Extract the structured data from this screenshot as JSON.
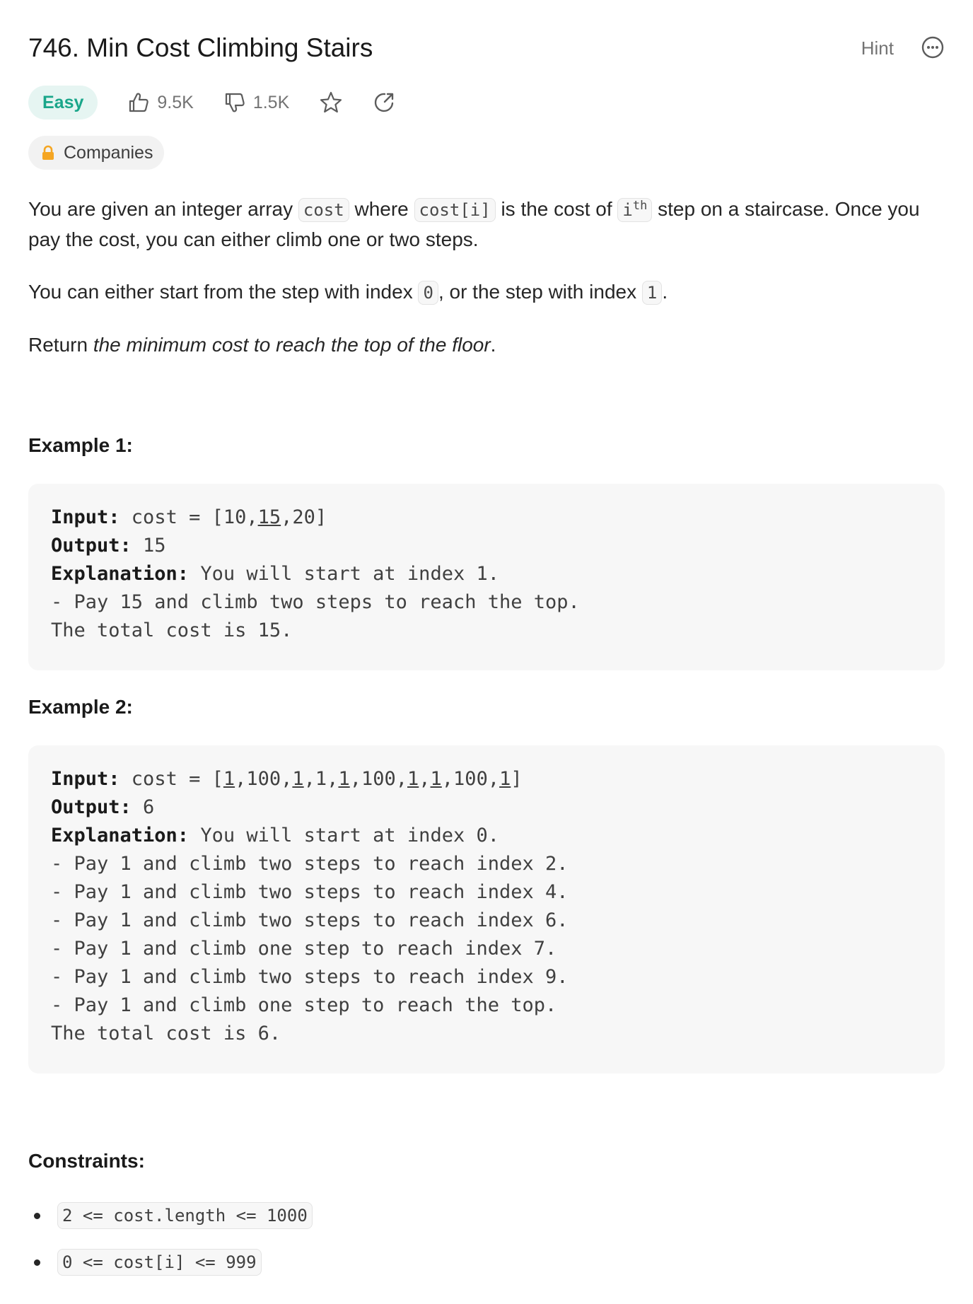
{
  "problem": {
    "title": "746. Min Cost Climbing Stairs",
    "hint_label": "Hint",
    "difficulty": "Easy",
    "likes": "9.5K",
    "dislikes": "1.5K",
    "companies_label": "Companies"
  },
  "description": {
    "p1_a": "You are given an integer array ",
    "p1_code1": "cost",
    "p1_b": " where ",
    "p1_code2": "cost[i]",
    "p1_c": " is the cost of ",
    "p1_code3": "i",
    "p1_sup": "th",
    "p1_d": " step on a staircase. Once you pay the cost, you can either climb one or two steps.",
    "p2_a": "You can either start from the step with index ",
    "p2_code1": "0",
    "p2_b": ", or the step with index ",
    "p2_code2": "1",
    "p2_c": ".",
    "p3_a": "Return ",
    "p3_em": "the minimum cost to reach the top of the floor",
    "p3_b": "."
  },
  "example1": {
    "title": "Example 1:",
    "input_label": "Input:",
    "input_pre": " cost = [10,",
    "input_u": "15",
    "input_post": ",20]",
    "output_label": "Output:",
    "output_value": " 15",
    "explanation_label": "Explanation:",
    "explanation_value": " You will start at index 1.",
    "lines": [
      "- Pay 15 and climb two steps to reach the top.",
      "The total cost is 15."
    ]
  },
  "example2": {
    "title": "Example 2:",
    "input_label": "Input:",
    "input_parts": [
      {
        "t": " cost = [",
        "u": false
      },
      {
        "t": "1",
        "u": true
      },
      {
        "t": ",100,",
        "u": false
      },
      {
        "t": "1",
        "u": true
      },
      {
        "t": ",1,",
        "u": false
      },
      {
        "t": "1",
        "u": true
      },
      {
        "t": ",100,",
        "u": false
      },
      {
        "t": "1",
        "u": true
      },
      {
        "t": ",",
        "u": false
      },
      {
        "t": "1",
        "u": true
      },
      {
        "t": ",100,",
        "u": false
      },
      {
        "t": "1",
        "u": true
      },
      {
        "t": "]",
        "u": false
      }
    ],
    "output_label": "Output:",
    "output_value": " 6",
    "explanation_label": "Explanation:",
    "explanation_value": " You will start at index 0.",
    "lines": [
      "- Pay 1 and climb two steps to reach index 2.",
      "- Pay 1 and climb two steps to reach index 4.",
      "- Pay 1 and climb two steps to reach index 6.",
      "- Pay 1 and climb one step to reach index 7.",
      "- Pay 1 and climb two steps to reach index 9.",
      "- Pay 1 and climb one step to reach the top.",
      "The total cost is 6."
    ]
  },
  "constraints": {
    "title": "Constraints:",
    "items": [
      "2 <= cost.length <= 1000",
      "0 <= cost[i] <= 999"
    ]
  },
  "colors": {
    "easy_text": "#1aa68a",
    "easy_bg": "#e6f5f2",
    "lock": "#f5a623"
  },
  "icons": [
    "thumbs-up-icon",
    "thumbs-down-icon",
    "star-icon",
    "share-icon",
    "lock-icon",
    "more-icon"
  ]
}
